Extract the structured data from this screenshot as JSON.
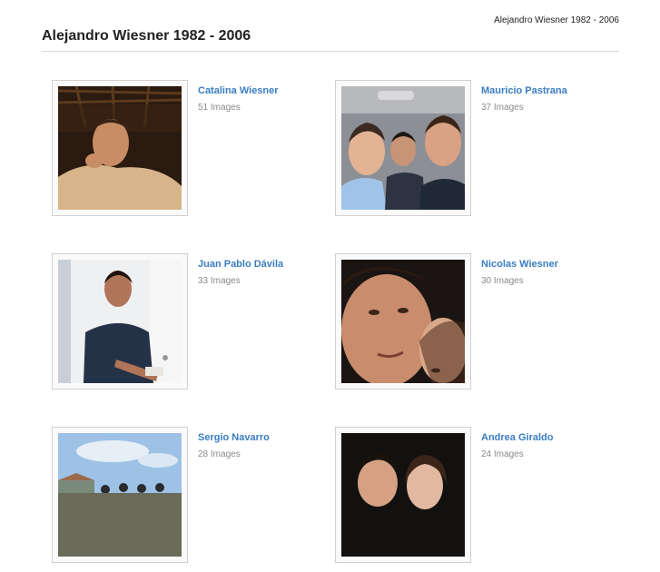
{
  "header": {
    "site_name": "Alejandro Wiesner 1982 - 2006",
    "page_title": "Alejandro Wiesner 1982 - 2006"
  },
  "albums": [
    {
      "title": "Catalina Wiesner",
      "count": "51 Images",
      "photo": "blowing-kiss"
    },
    {
      "title": "Mauricio Pastrana",
      "count": "37 Images",
      "photo": "car-selfie"
    },
    {
      "title": "Juan Pablo Dávila",
      "count": "33 Images",
      "photo": "portrait-by-door"
    },
    {
      "title": "Nicolas Wiesner",
      "count": "30 Images",
      "photo": "closeup-selfie"
    },
    {
      "title": "Sergio Navarro",
      "count": "28 Images",
      "photo": "group-outdoors"
    },
    {
      "title": "Andrea Giraldo",
      "count": "24 Images",
      "photo": "couple-night"
    }
  ]
}
